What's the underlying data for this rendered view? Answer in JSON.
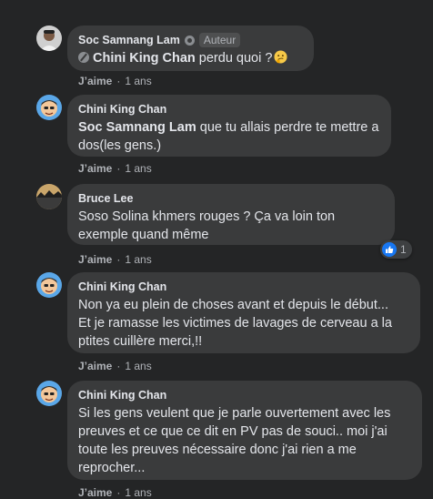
{
  "colors": {
    "background": "#242526",
    "bubble": "#3a3b3c",
    "text_primary": "#e4e6eb",
    "text_secondary": "#b0b3b8",
    "like_blue": "#1877f2"
  },
  "comments": [
    {
      "author": "Soc Samnang Lam",
      "author_badge": "Auteur",
      "mention": "Chini King Chan",
      "text": "perdu quoi ?",
      "emoji": "thinking-face-emoji",
      "like_label": "J’aime",
      "time": "1 ans"
    },
    {
      "author": "Chini King Chan",
      "mention": "Soc Samnang Lam",
      "text": "que tu allais perdre te mettre a dos(les gens.)",
      "like_label": "J’aime",
      "time": "1 ans"
    },
    {
      "author": "Bruce Lee",
      "text": "Soso Solina khmers rouges ? Ça va loin ton exemple quand même",
      "like_label": "J’aime",
      "time": "1 ans",
      "reaction_icon": "thumbs-up-icon",
      "reaction_count": "1"
    },
    {
      "author": "Chini King Chan",
      "text": "Non ya eu plein de choses avant et depuis le début... Et je ramasse les victimes de lavages de cerveau a la ptites cuillère merci,!!",
      "like_label": "J’aime",
      "time": "1 ans"
    },
    {
      "author": "Chini King Chan",
      "text": "Si les gens veulent que je parle ouvertement avec les preuves et ce que ce dit en PV pas de souci.. moi j'ai toute les preuves nécessaire donc j'ai rien a me reprocher...",
      "like_label": "J’aime",
      "time": "1 ans"
    }
  ]
}
